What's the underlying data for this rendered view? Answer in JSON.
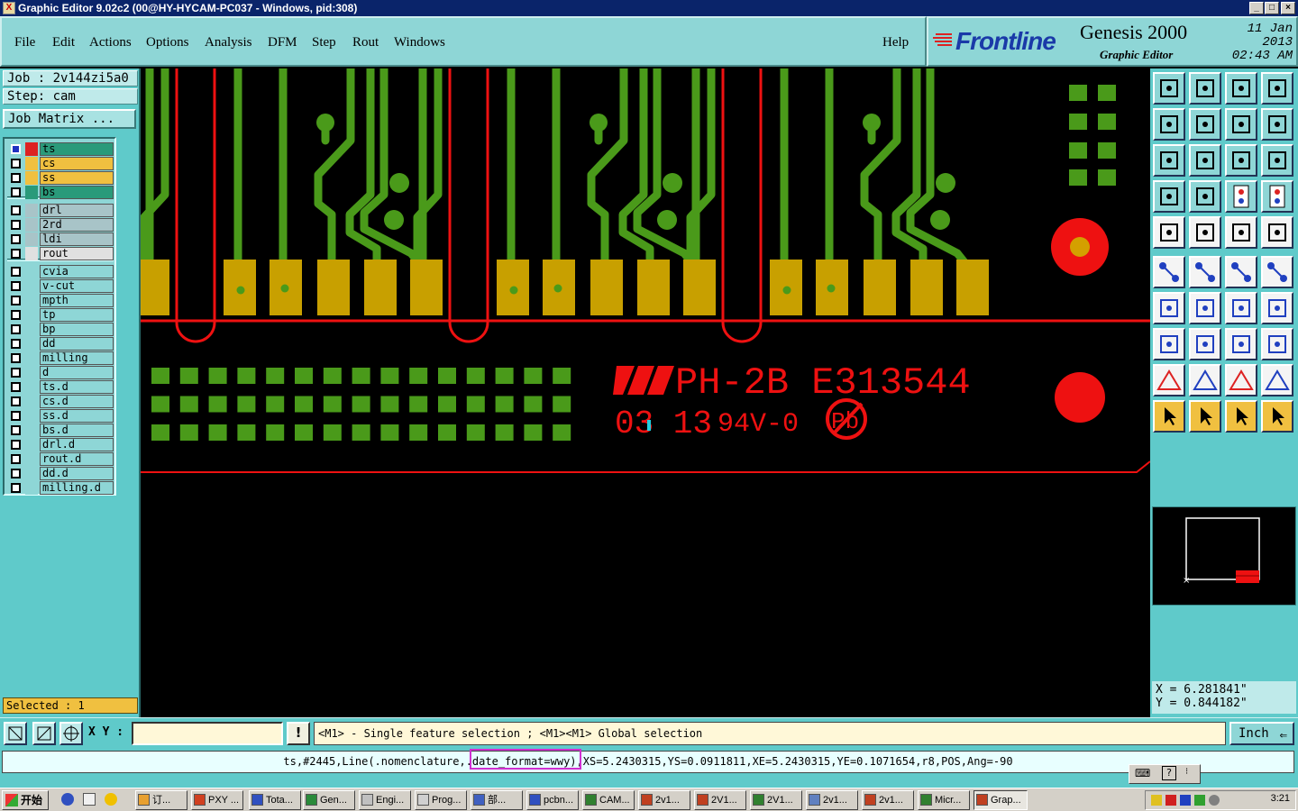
{
  "window": {
    "title": "Graphic Editor 9.02c2 (00@HY-HYCAM-PC037 - Windows, pid:308)"
  },
  "menu": {
    "items": [
      "File",
      "Edit",
      "Actions",
      "Options",
      "Analysis",
      "DFM",
      "Step",
      "Rout",
      "Windows"
    ],
    "help": "Help"
  },
  "brand": {
    "logo": "Frontline",
    "product": "Genesis 2000",
    "subtitle": "Graphic Editor",
    "date": "11 Jan 2013",
    "time": "02:43 AM"
  },
  "job": {
    "job": "Job : 2v144zi5a0",
    "step": "Step: cam",
    "matrix_button": "Job Matrix ..."
  },
  "layers": {
    "group1": [
      {
        "name": "ts",
        "color": "#2a9a7a",
        "active": true
      },
      {
        "name": "cs",
        "color": "#f0c040"
      },
      {
        "name": "ss",
        "color": "#f0c040"
      },
      {
        "name": "bs",
        "color": "#2a9a7a"
      }
    ],
    "group2": [
      {
        "name": "drl",
        "color": "#a8c4c8"
      },
      {
        "name": "2rd",
        "color": "#a8c4c8"
      },
      {
        "name": "ldi",
        "color": "#a8c4c8"
      },
      {
        "name": "rout",
        "color": "#e0e0e0"
      }
    ],
    "group3": [
      "cvia",
      "v-cut",
      "mpth",
      "tp",
      "bp",
      "dd",
      "milling",
      "d",
      "ts.d",
      "cs.d",
      "ss.d",
      "bs.d",
      "drl.d",
      "rout.d",
      "dd.d",
      "milling.d"
    ]
  },
  "selected": "Selected : 1",
  "board": {
    "marking_line1": "PH-2B E313544",
    "marking_date": "03 13",
    "marking_rating": "94V-0",
    "marking_pb": "Pb"
  },
  "coords": {
    "x": "X  =  6.281841\"",
    "y": "Y  =  0.844182\""
  },
  "bottom": {
    "xy_label": "X Y :",
    "xy_value": "",
    "bang": "!",
    "hint": "<M1> - Single feature selection ; <M1><M1> Global selection",
    "unit": "Inch"
  },
  "info": {
    "pre": "ts,#2445,Line(.nomenclature,",
    "highlight": ".date_format=wwy",
    "post": "),XS=5.2430315,YS=0.0911811,XE=5.2430315,YE=0.1071654,r8,POS,Ang=-90"
  },
  "taskbar": {
    "start": "开始",
    "tasks": [
      "订...",
      "PXY ...",
      "Tota...",
      "Gen...",
      "Engi...",
      "Prog...",
      "部...",
      "pcbn...",
      "CAM...",
      "2v1...",
      "2V1...",
      "2V1...",
      "2v1...",
      "2v1...",
      "Micr...",
      "Grap..."
    ],
    "clock": "3:21"
  },
  "colors": {
    "accent": "#8ed6d6",
    "trace": "#4a9a1a",
    "pad": "#c8a000",
    "outline": "#ee1111"
  }
}
